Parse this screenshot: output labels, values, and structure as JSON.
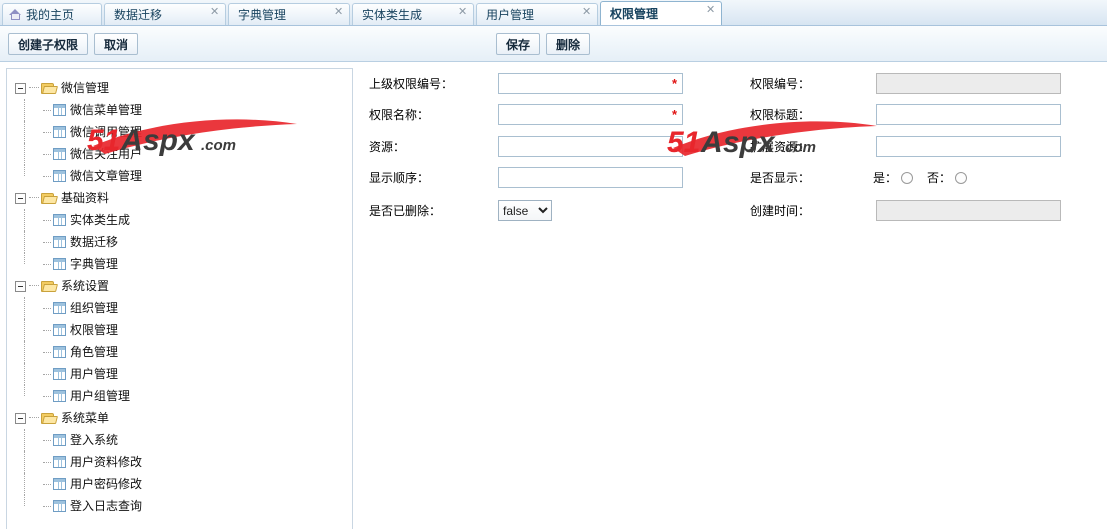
{
  "tabs": [
    {
      "label": "我的主页",
      "icon": "home-icon",
      "closable": false,
      "active": false
    },
    {
      "label": "数据迁移",
      "closable": true,
      "active": false
    },
    {
      "label": "字典管理",
      "closable": true,
      "active": false
    },
    {
      "label": "实体类生成",
      "closable": true,
      "active": false
    },
    {
      "label": "用户管理",
      "closable": true,
      "active": false
    },
    {
      "label": "权限管理",
      "closable": true,
      "active": true
    }
  ],
  "tab_close_glyph": "✕",
  "toolbar": {
    "create_label": "创建子权限",
    "cancel_label": "取消",
    "save_label": "保存",
    "delete_label": "删除"
  },
  "tree": {
    "groups": [
      {
        "label": "微信管理",
        "icon": "folder-icon",
        "expanded": true,
        "children": [
          {
            "label": "微信菜单管理",
            "icon": "grid-icon"
          },
          {
            "label": "微信调用管理",
            "icon": "grid-icon"
          },
          {
            "label": "微信关注用户",
            "icon": "grid-icon"
          },
          {
            "label": "微信文章管理",
            "icon": "grid-icon"
          }
        ]
      },
      {
        "label": "基础资料",
        "icon": "folder-icon",
        "expanded": true,
        "children": [
          {
            "label": "实体类生成",
            "icon": "grid-icon"
          },
          {
            "label": "数据迁移",
            "icon": "grid-icon"
          },
          {
            "label": "字典管理",
            "icon": "grid-icon"
          }
        ]
      },
      {
        "label": "系统设置",
        "icon": "folder-icon",
        "expanded": true,
        "children": [
          {
            "label": "组织管理",
            "icon": "grid-icon"
          },
          {
            "label": "权限管理",
            "icon": "grid-icon"
          },
          {
            "label": "角色管理",
            "icon": "grid-icon"
          },
          {
            "label": "用户管理",
            "icon": "grid-icon"
          },
          {
            "label": "用户组管理",
            "icon": "grid-icon"
          }
        ]
      },
      {
        "label": "系统菜单",
        "icon": "folder-icon",
        "expanded": true,
        "children": [
          {
            "label": "登入系统",
            "icon": "grid-icon"
          },
          {
            "label": "用户资料修改",
            "icon": "grid-icon"
          },
          {
            "label": "用户密码修改",
            "icon": "grid-icon"
          },
          {
            "label": "登入日志查询",
            "icon": "grid-icon"
          }
        ]
      }
    ]
  },
  "form": {
    "left": {
      "parent_id_label": "上级权限编号：",
      "parent_id_value": "",
      "parent_id_required": "*",
      "name_label": "权限名称：",
      "name_value": "",
      "name_required": "*",
      "resource_label": "资源：",
      "resource_value": "",
      "order_label": "显示顺序：",
      "order_value": "",
      "deleted_label": "是否已删除：",
      "deleted_value": "false",
      "deleted_options": [
        "false",
        "true"
      ]
    },
    "right": {
      "id_label": "权限编号：",
      "id_value": "",
      "title_label": "权限标题：",
      "title_value": "",
      "ext_resource_label": "扩展资源：",
      "ext_resource_value": "",
      "visible_label": "是否显示：",
      "visible_yes_label": "是：",
      "visible_no_label": "否：",
      "created_label": "创建时间：",
      "created_value": ""
    }
  },
  "watermark": {
    "text_51": "51",
    "text_aspx": "Aspx",
    "text_com": ".com",
    "red": "#e8262c",
    "dark": "#3c3c3c"
  },
  "colors": {
    "accent": "#a8c3dc",
    "tab_active_bg": "#ffffff",
    "required_red": "#e01313",
    "tree_border": "#c9d6e2",
    "readonly_bg": "#ececec"
  }
}
